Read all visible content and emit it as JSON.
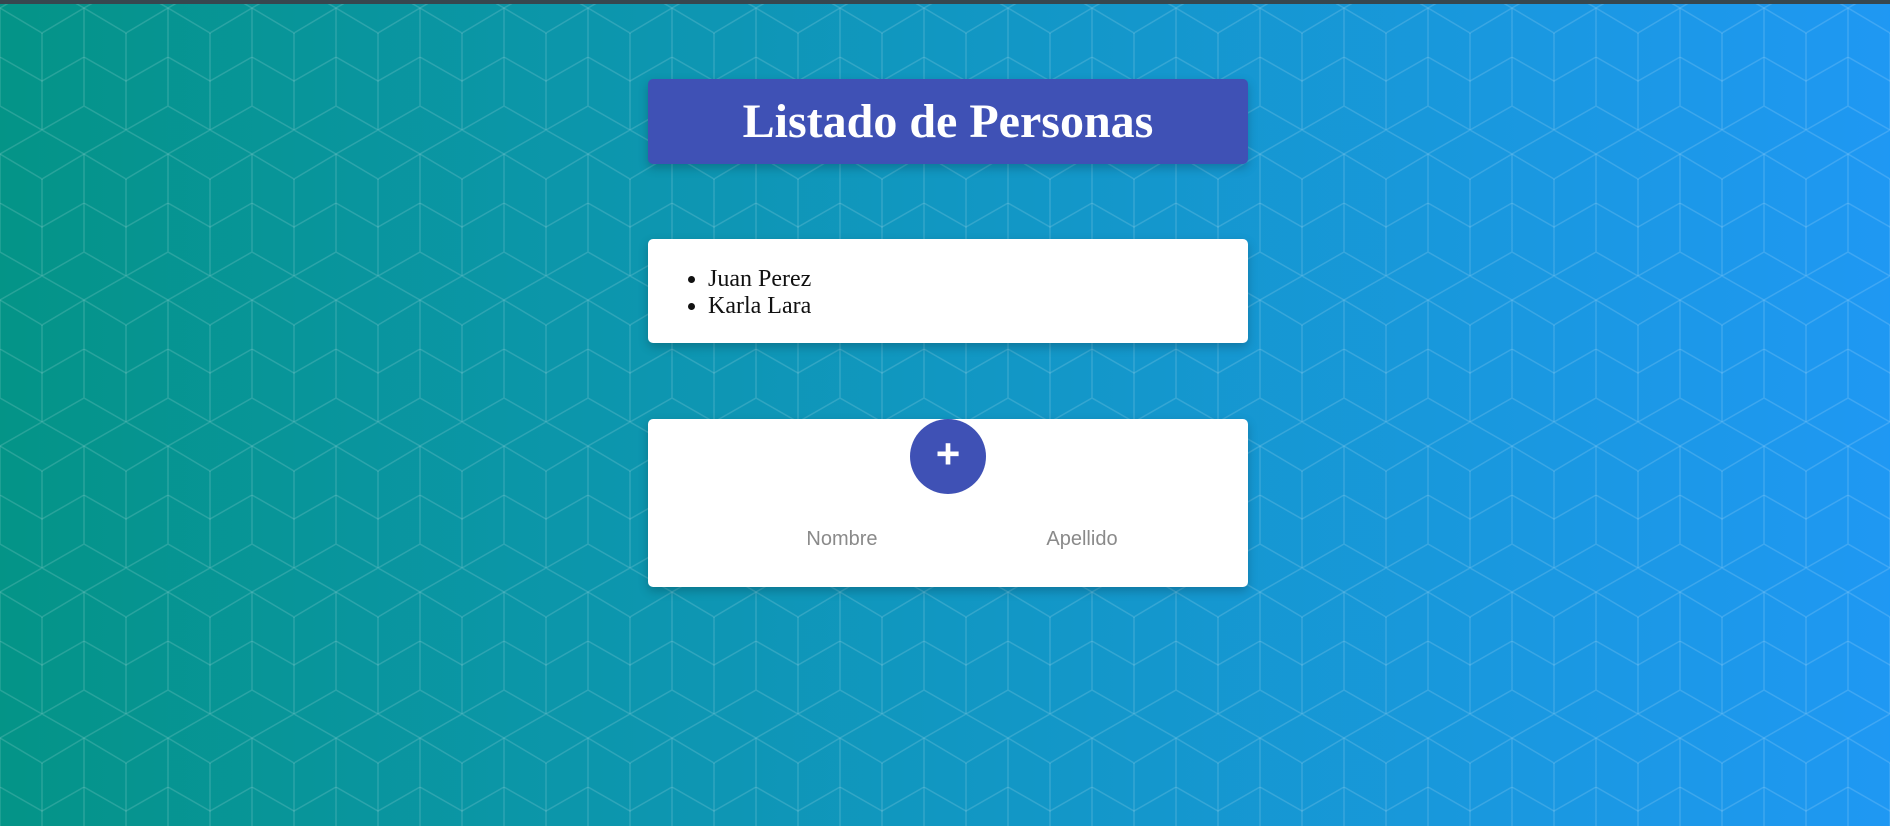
{
  "header": {
    "title": "Listado de Personas"
  },
  "people": {
    "items": [
      {
        "name": "Juan Perez"
      },
      {
        "name": "Karla Lara"
      }
    ]
  },
  "form": {
    "add_icon": "plus-icon",
    "add_glyph": "+",
    "first_name": {
      "value": "",
      "placeholder": "Nombre"
    },
    "last_name": {
      "value": "",
      "placeholder": "Apellido"
    }
  },
  "colors": {
    "primary": "#3f51b5",
    "background_start": "#049487",
    "background_end": "#1f98f3",
    "card": "#ffffff"
  }
}
